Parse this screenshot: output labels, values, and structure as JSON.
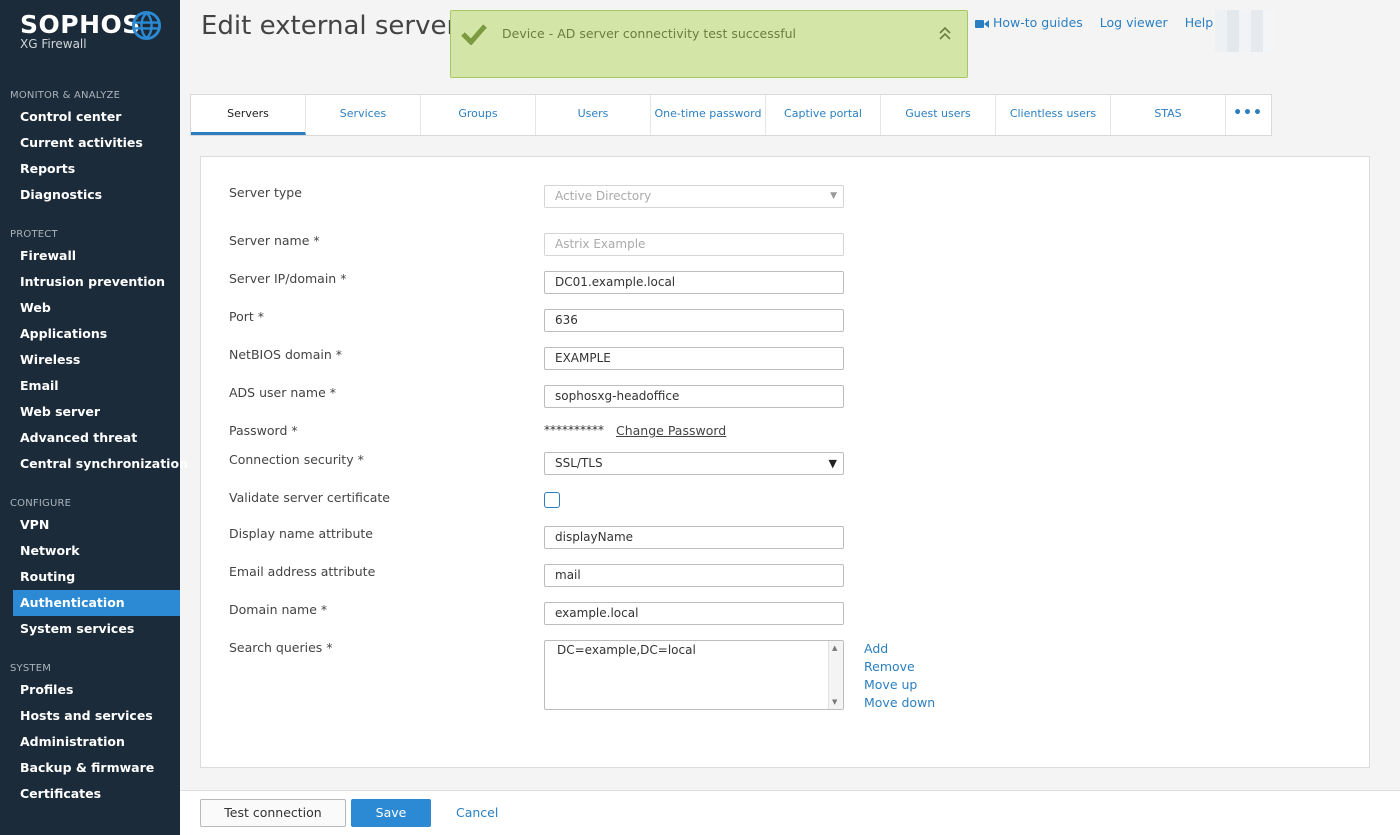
{
  "brand": {
    "name": "SOPHOS",
    "product": "XG Firewall"
  },
  "sidebar": {
    "sections": [
      {
        "heading": "MONITOR & ANALYZE",
        "items": [
          "Control center",
          "Current activities",
          "Reports",
          "Diagnostics"
        ]
      },
      {
        "heading": "PROTECT",
        "items": [
          "Firewall",
          "Intrusion prevention",
          "Web",
          "Applications",
          "Wireless",
          "Email",
          "Web server",
          "Advanced threat",
          "Central synchronization"
        ]
      },
      {
        "heading": "CONFIGURE",
        "items": [
          "VPN",
          "Network",
          "Routing",
          "Authentication",
          "System services"
        ]
      },
      {
        "heading": "SYSTEM",
        "items": [
          "Profiles",
          "Hosts and services",
          "Administration",
          "Backup & firmware",
          "Certificates"
        ]
      }
    ],
    "active_item": "Authentication"
  },
  "page_title": "Edit external server",
  "notification": {
    "text": "Device - AD server connectivity test successful",
    "status_color": "#d3e6a8"
  },
  "top_links": {
    "howto": "How-to guides",
    "log": "Log viewer",
    "help": "Help"
  },
  "tabs": [
    "Servers",
    "Services",
    "Groups",
    "Users",
    "One-time password",
    "Captive portal",
    "Guest users",
    "Clientless users",
    "STAS"
  ],
  "tab_more": "•••",
  "form": {
    "server_type": {
      "label": "Server type",
      "value": "Active Directory"
    },
    "server_name": {
      "label": "Server name *",
      "value": "Astrix Example"
    },
    "server_ip": {
      "label": "Server IP/domain *",
      "value": "DC01.example.local"
    },
    "port": {
      "label": "Port *",
      "value": "636"
    },
    "netbios": {
      "label": "NetBIOS domain *",
      "value": "EXAMPLE"
    },
    "ads_user": {
      "label": "ADS user name *",
      "value": "sophosxg-headoffice"
    },
    "password": {
      "label": "Password *",
      "value": "**********",
      "change_link": "Change Password"
    },
    "conn_security": {
      "label": "Connection security *",
      "value": "SSL/TLS"
    },
    "validate_cert": {
      "label": "Validate server certificate",
      "checked": false
    },
    "display_name_attr": {
      "label": "Display name attribute",
      "value": "displayName"
    },
    "email_attr": {
      "label": "Email address attribute",
      "value": "mail"
    },
    "domain_name": {
      "label": "Domain name *",
      "value": "example.local"
    },
    "search_queries": {
      "label": "Search queries *",
      "value": "DC=example,DC=local",
      "actions": [
        "Add",
        "Remove",
        "Move up",
        "Move down"
      ]
    }
  },
  "buttons": {
    "test": "Test connection",
    "save": "Save",
    "cancel": "Cancel"
  },
  "colors": {
    "accent": "#2b8ad3",
    "sidebar_bg": "#1c2b39",
    "link": "#2b7fc1"
  }
}
